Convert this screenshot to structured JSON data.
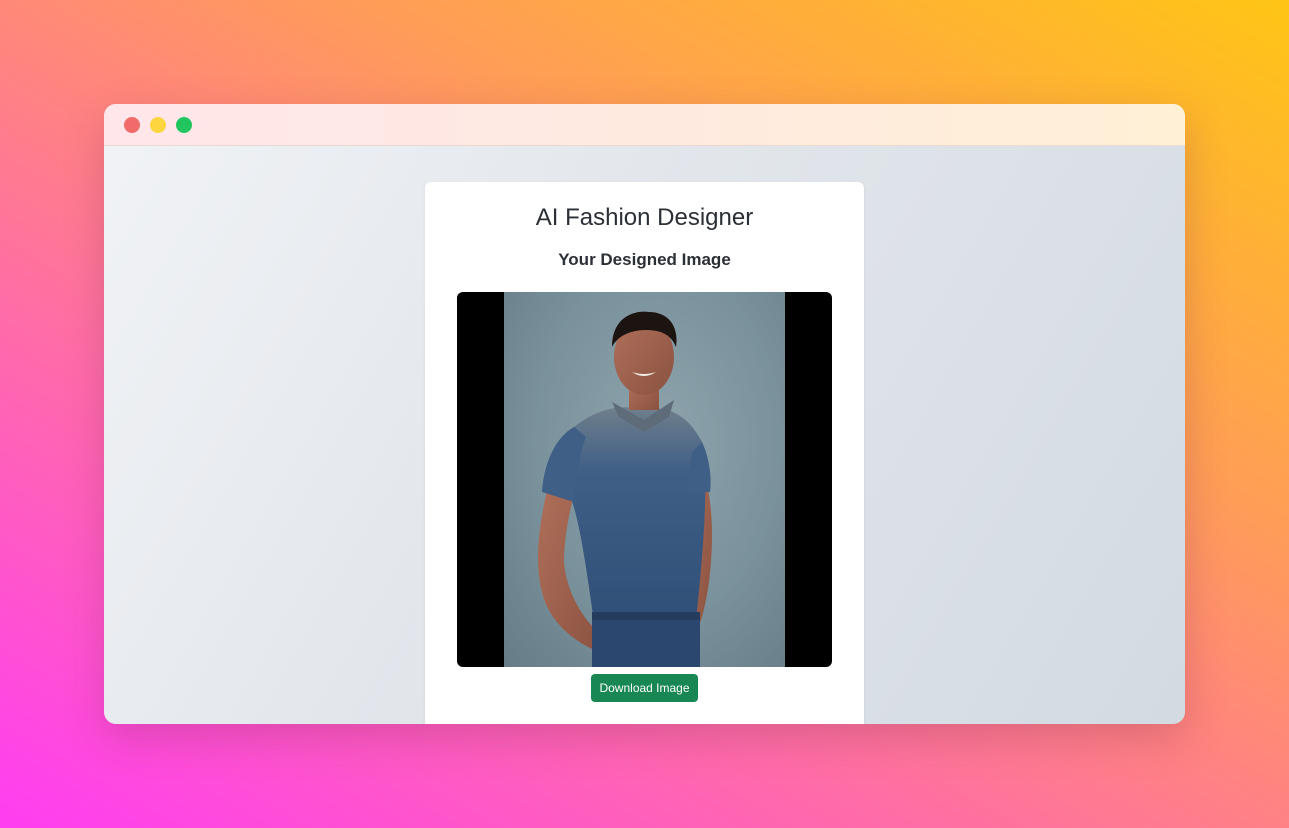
{
  "app": {
    "title": "AI Fashion Designer",
    "subtitle": "Your Designed Image"
  },
  "actions": {
    "download_label": "Download Image"
  },
  "window_controls": [
    "close",
    "minimize",
    "maximize"
  ],
  "colors": {
    "close": "#f26b6b",
    "minimize": "#fcd53f",
    "maximize": "#22c55e",
    "button": "#198754"
  }
}
